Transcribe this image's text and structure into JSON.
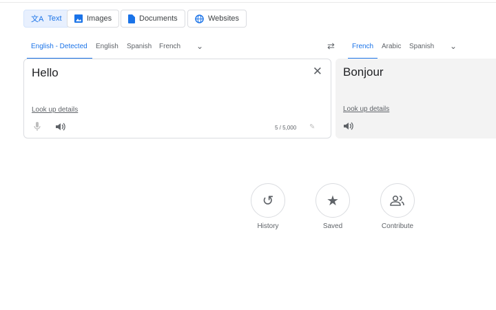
{
  "modes": [
    {
      "label": "Text"
    },
    {
      "label": "Images"
    },
    {
      "label": "Documents"
    },
    {
      "label": "Websites"
    }
  ],
  "source_langs": [
    "English - Detected",
    "English",
    "Spanish",
    "French"
  ],
  "target_langs": [
    "French",
    "Arabic",
    "Spanish"
  ],
  "source": {
    "text": "Hello",
    "lookup": "Look up details",
    "count": "5 / 5,000"
  },
  "target": {
    "text": "Bonjour",
    "lookup": "Look up details"
  },
  "actions": [
    {
      "label": "History"
    },
    {
      "label": "Saved"
    },
    {
      "label": "Contribute"
    }
  ]
}
